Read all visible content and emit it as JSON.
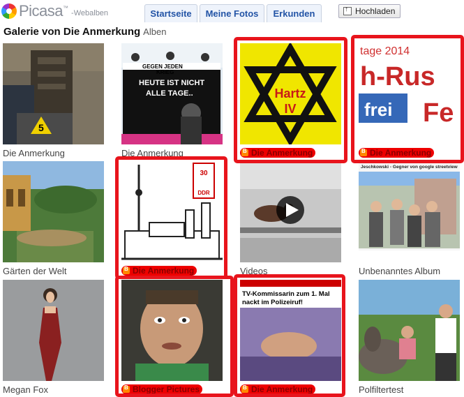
{
  "app": {
    "brand": "Picasa",
    "brand_suffix": "-Webalben"
  },
  "nav": {
    "tabs": [
      "Startseite",
      "Meine Fotos",
      "Erkunden"
    ],
    "upload_label": "Hochladen"
  },
  "gallery": {
    "title": "Galerie von Die Anmerkung",
    "subtitle": "Alben"
  },
  "albums": [
    {
      "label": "Die Anmerkung",
      "blogger": false,
      "highlighted": false,
      "image": "crime scene staircase with evidence marker 5"
    },
    {
      "label": "Die Anmerkung",
      "blogger": false,
      "highlighted": false,
      "image": "banner protest",
      "image_text": [
        "GEGEN JEDEN KRIEG",
        "HEUTE IST NICHT",
        "ALLE TAGE.."
      ]
    },
    {
      "label": "Die Anmerkung",
      "blogger": true,
      "highlighted": true,
      "image": "star with text",
      "image_text": [
        "Hartz",
        "IV"
      ]
    },
    {
      "label": "Die Anmerkung",
      "blogger": true,
      "highlighted": true,
      "image": "poster text",
      "image_text": [
        "tage 2014",
        "h-Rus",
        "frei",
        "Fe"
      ]
    },
    {
      "label": "Gärten der Welt",
      "blogger": false,
      "highlighted": false,
      "image": "garden"
    },
    {
      "label": "Die Anmerkung",
      "blogger": true,
      "highlighted": true,
      "image": "berlin skyline drawing",
      "image_text": [
        "30",
        "DDR"
      ]
    },
    {
      "label": "Videos",
      "blogger": false,
      "highlighted": false,
      "image": "bird video with play button"
    },
    {
      "label": "Unbenanntes Album",
      "blogger": false,
      "highlighted": false,
      "image": "group of people",
      "image_text": [
        "Jeschkowski - Gegner von google streetview"
      ]
    },
    {
      "label": "Megan Fox",
      "blogger": false,
      "highlighted": false,
      "image": "woman in red dress"
    },
    {
      "label": "Blogger Pictures",
      "blogger": true,
      "highlighted": true,
      "image": "face close up"
    },
    {
      "label": "Die Anmerkung",
      "blogger": true,
      "highlighted": true,
      "image": "tabloid page",
      "image_text": [
        "TV-Kommissarin zum 1. Mal",
        "nackt im Polizeiruf!"
      ]
    },
    {
      "label": "Polfiltertest",
      "blogger": false,
      "highlighted": false,
      "image": "donkey and woman"
    }
  ],
  "colors": {
    "accent": "#2354a6",
    "highlight": "#e8141c",
    "brand_gray": "#8a8f99"
  }
}
